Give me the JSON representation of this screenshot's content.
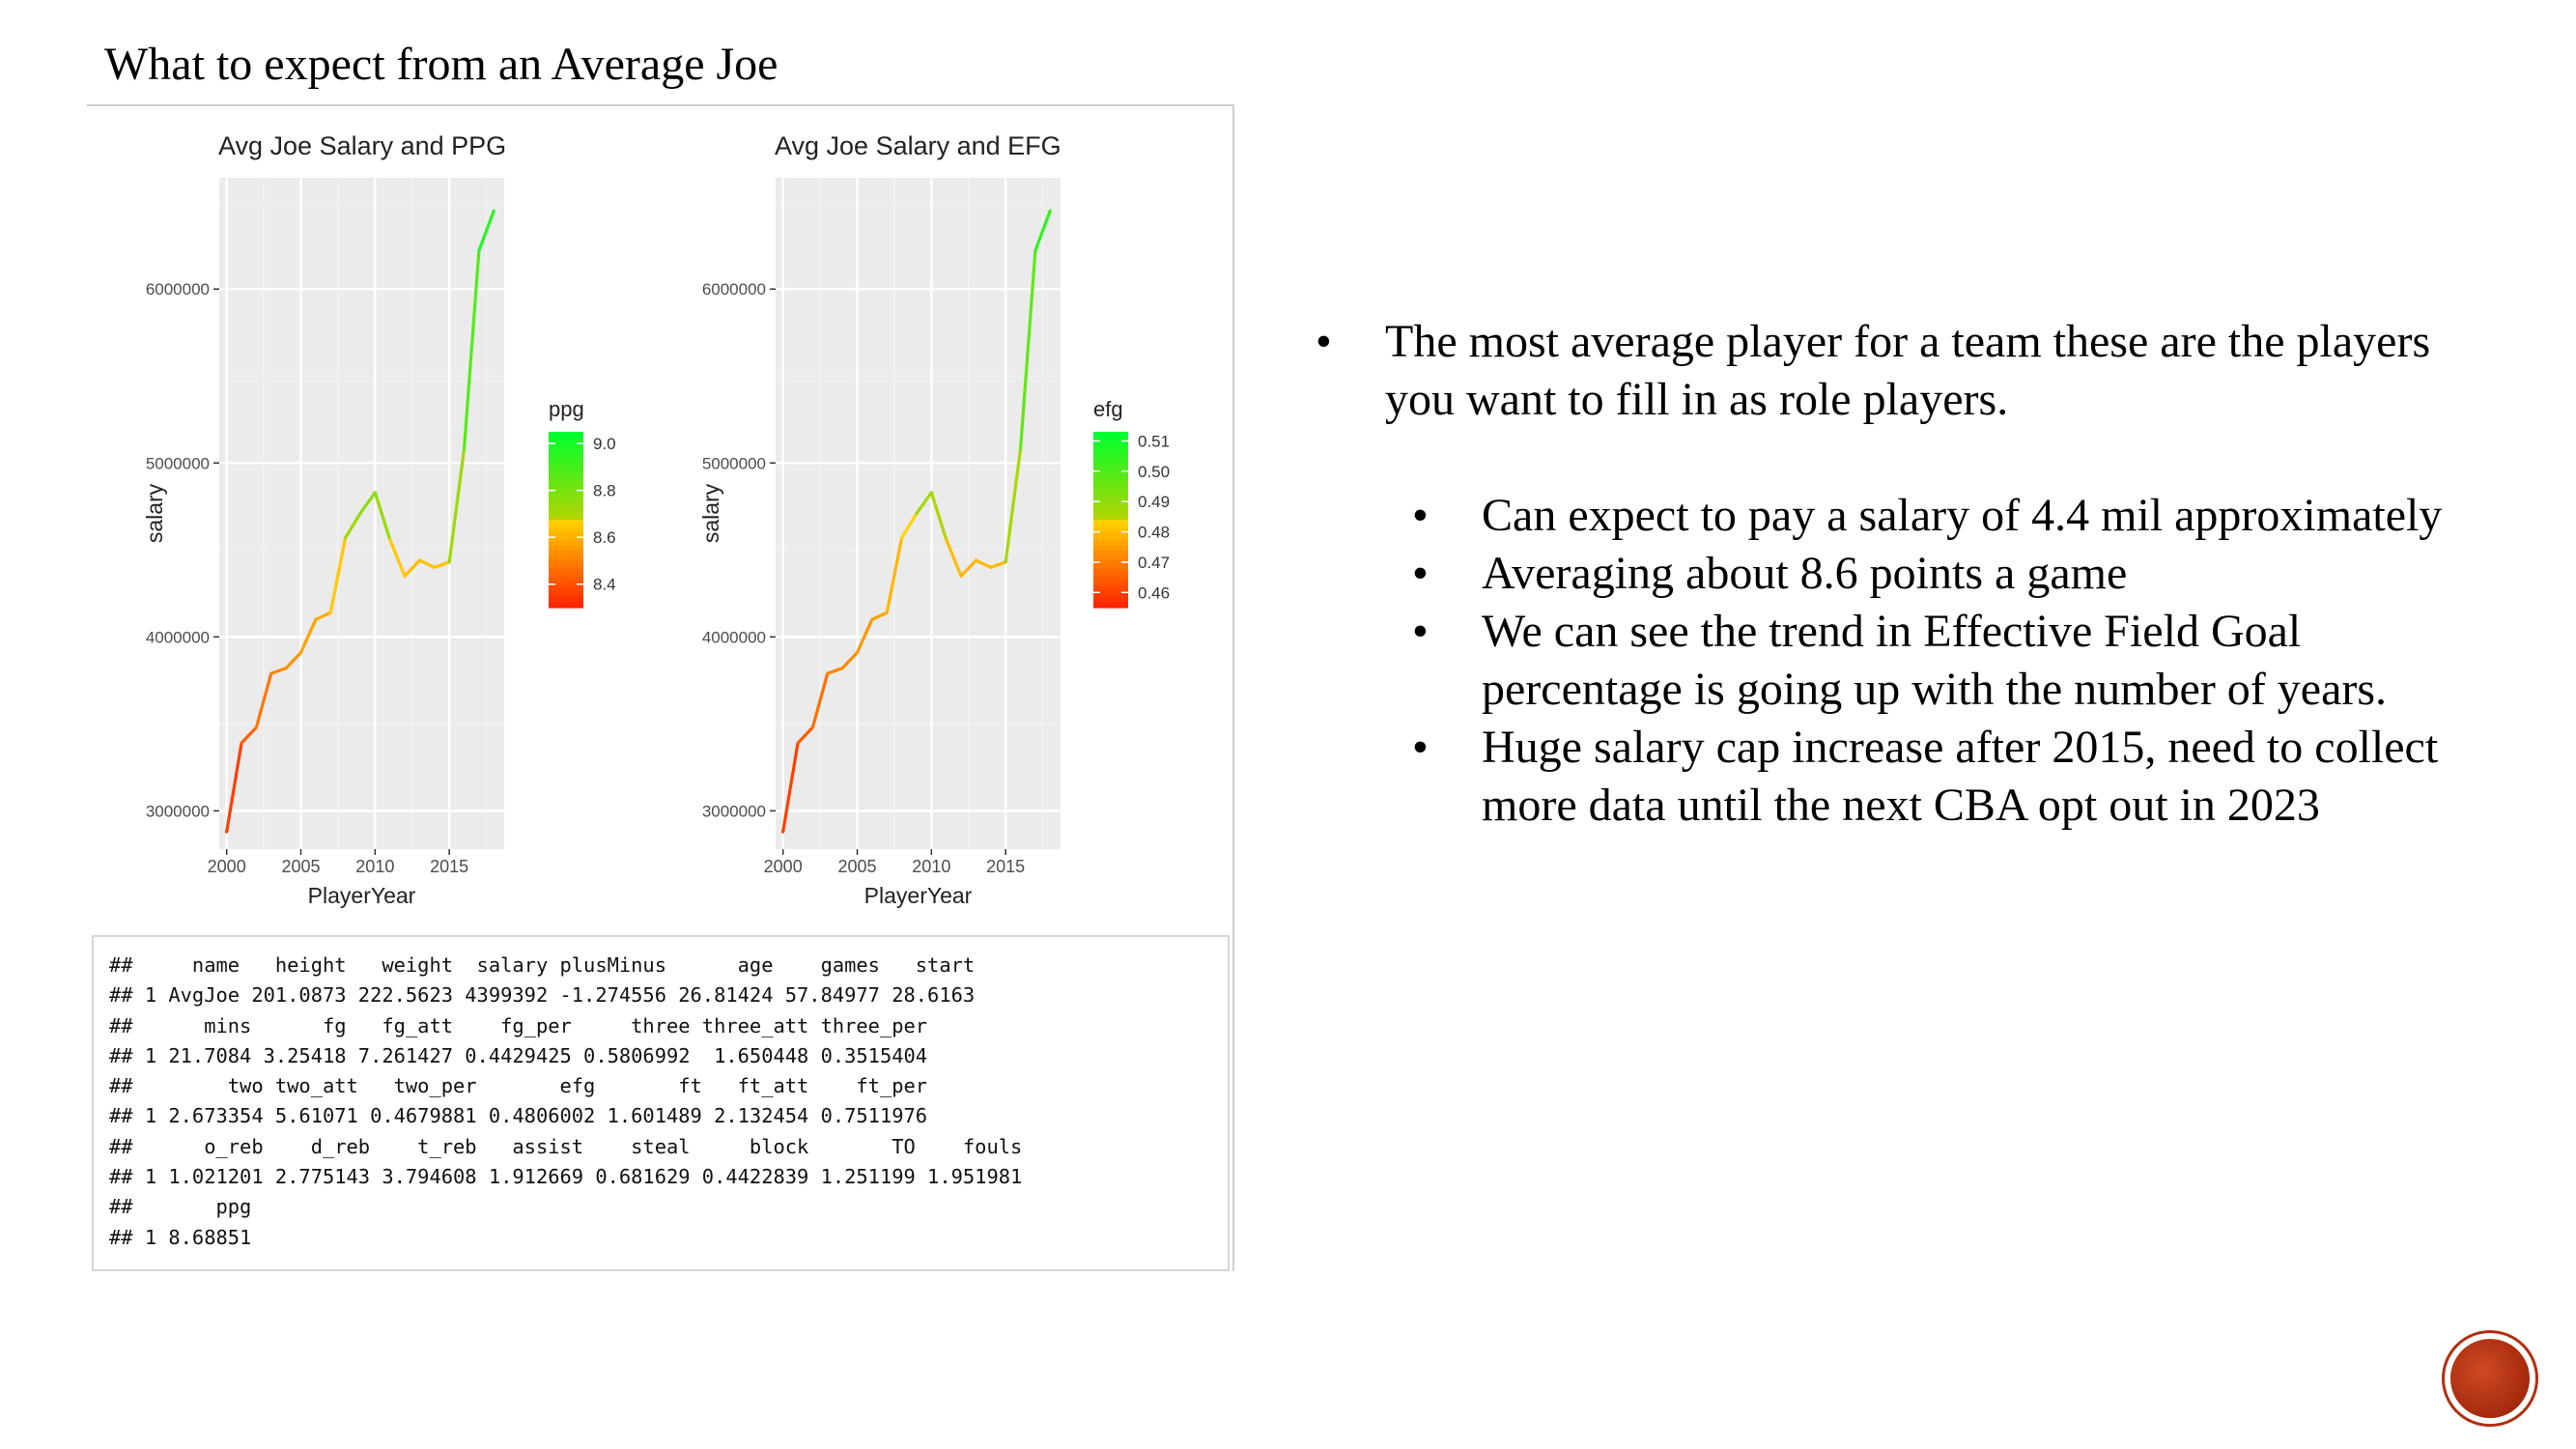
{
  "slide": {
    "title": "What to expect from an Average Joe"
  },
  "charts": [
    {
      "title": "Avg Joe Salary and PPG",
      "xlabel": "PlayerYear",
      "ylabel": "salary",
      "legend_title": "ppg",
      "legend_ticks": [
        "9.0",
        "8.8",
        "8.6",
        "8.4"
      ],
      "x_ticks": [
        "2000",
        "2005",
        "2010",
        "2015"
      ],
      "y_ticks": [
        "3000000",
        "4000000",
        "5000000",
        "6000000"
      ]
    },
    {
      "title": "Avg Joe Salary and EFG",
      "xlabel": "PlayerYear",
      "ylabel": "salary",
      "legend_title": "efg",
      "legend_ticks": [
        "0.51",
        "0.50",
        "0.49",
        "0.48",
        "0.47",
        "0.46"
      ],
      "x_ticks": [
        "2000",
        "2005",
        "2010",
        "2015"
      ],
      "y_ticks": [
        "3000000",
        "4000000",
        "5000000",
        "6000000"
      ]
    }
  ],
  "chart_data": [
    {
      "type": "line",
      "title": "Avg Joe Salary and PPG",
      "xlabel": "PlayerYear",
      "ylabel": "salary",
      "xlim": [
        1999.5,
        2018.7
      ],
      "ylim": [
        2780000,
        6640000
      ],
      "color_by": "ppg",
      "color_range": [
        8.3,
        9.05
      ],
      "x": [
        2000,
        2001,
        2002,
        2003,
        2004,
        2005,
        2006,
        2007,
        2008,
        2009,
        2010,
        2011,
        2012,
        2013,
        2014,
        2015,
        2016,
        2017,
        2018
      ],
      "values": [
        2880000,
        3390000,
        3480000,
        3790000,
        3820000,
        3910000,
        4100000,
        4140000,
        4570000,
        4710000,
        4830000,
        4560000,
        4350000,
        4440000,
        4400000,
        4430000,
        5080000,
        6220000,
        6450000
      ],
      "ppg": [
        8.3,
        8.4,
        8.45,
        8.5,
        8.52,
        8.55,
        8.58,
        8.6,
        8.7,
        8.75,
        8.78,
        8.68,
        8.62,
        8.64,
        8.63,
        8.64,
        8.8,
        8.95,
        9.0
      ],
      "legend": {
        "title": "ppg",
        "position": "right",
        "ticks": [
          9.0,
          8.8,
          8.6,
          8.4
        ],
        "low_color": "#ff2600",
        "high_color": "#00ff2e"
      },
      "grid": true
    },
    {
      "type": "line",
      "title": "Avg Joe Salary and EFG",
      "xlabel": "PlayerYear",
      "ylabel": "salary",
      "xlim": [
        1999.5,
        2018.7
      ],
      "ylim": [
        2780000,
        6640000
      ],
      "color_by": "efg",
      "color_range": [
        0.455,
        0.513
      ],
      "x": [
        2000,
        2001,
        2002,
        2003,
        2004,
        2005,
        2006,
        2007,
        2008,
        2009,
        2010,
        2011,
        2012,
        2013,
        2014,
        2015,
        2016,
        2017,
        2018
      ],
      "values": [
        2880000,
        3390000,
        3480000,
        3790000,
        3820000,
        3910000,
        4100000,
        4140000,
        4570000,
        4710000,
        4830000,
        4560000,
        4350000,
        4440000,
        4400000,
        4430000,
        5080000,
        6220000,
        6450000
      ],
      "efg": [
        0.456,
        0.462,
        0.465,
        0.47,
        0.471,
        0.473,
        0.475,
        0.476,
        0.482,
        0.486,
        0.488,
        0.482,
        0.478,
        0.48,
        0.479,
        0.48,
        0.492,
        0.503,
        0.507
      ],
      "legend": {
        "title": "efg",
        "position": "right",
        "ticks": [
          0.51,
          0.5,
          0.49,
          0.48,
          0.47,
          0.46
        ],
        "low_color": "#ff2600",
        "high_color": "#00ff2e"
      },
      "grid": true
    }
  ],
  "console_lines": [
    "##     name   height   weight  salary plusMinus      age    games   start",
    "## 1 AvgJoe 201.0873 222.5623 4399392 -1.274556 26.81424 57.84977 28.6163",
    "##      mins      fg   fg_att    fg_per     three three_att three_per",
    "## 1 21.7084 3.25418 7.261427 0.4429425 0.5806992  1.650448 0.3515404",
    "##        two two_att   two_per       efg       ft   ft_att    ft_per",
    "## 1 2.673354 5.61071 0.4679881 0.4806002 1.601489 2.132454 0.7511976",
    "##      o_reb    d_reb    t_reb   assist    steal     block       TO    fouls",
    "## 1 1.021201 2.775143 3.794608 1.912669 0.681629 0.4422839 1.251199 1.951981",
    "##       ppg",
    "## 1 8.68851"
  ],
  "bullets": {
    "main": "The most average player for a team these are the players you want to fill in as role players.",
    "sub": [
      "Can expect to pay a salary of 4.4 mil approximately",
      "Averaging about 8.6 points a game",
      "We can see the trend in Effective Field Goal percentage is going up with the number of years.",
      "Huge salary cap increase after 2015, need to collect more data until the next CBA opt out in 2023"
    ],
    "marker": "•"
  },
  "colors": {
    "panel_bg": "#ebebeb",
    "grid": "#ffffff",
    "accent": "#b22e10"
  }
}
